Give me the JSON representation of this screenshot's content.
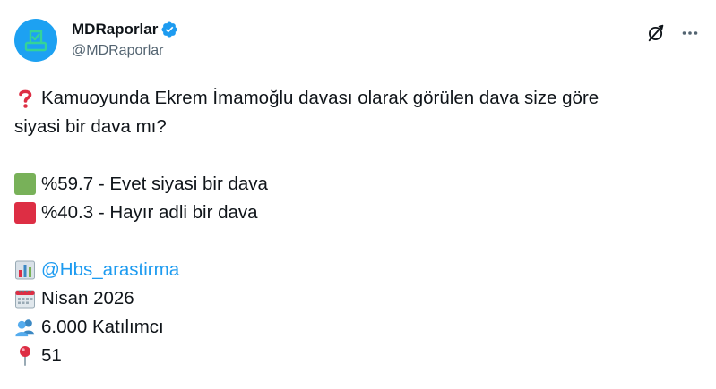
{
  "author": {
    "display_name": "MDRaporlar",
    "handle": "@MDRaporlar",
    "verified": true,
    "avatar_icon": "ballot-box-icon",
    "avatar_color": "#1da1f2"
  },
  "actions": {
    "grok_icon": "grok-icon",
    "more_icon": "more-dots-icon"
  },
  "tweet": {
    "question_line1": "Kamuoyunda Ekrem İmamoğlu davası olarak görülen dava size göre",
    "question_line2": "siyasi bir dava mı?",
    "result_yes": "%59.7 - Evet siyasi bir dava",
    "result_no": "%40.3 - Hayır adli bir dava",
    "source_mention": "@Hbs_arastirma",
    "date_text": "Nisan 2026",
    "participants_text": "6.000 Katılımcı",
    "pin_text": "51"
  },
  "colors": {
    "yes_square": "#78b159",
    "no_square": "#dd2e44",
    "link": "#1d9bf0",
    "verified_badge": "#1d9bf0"
  }
}
